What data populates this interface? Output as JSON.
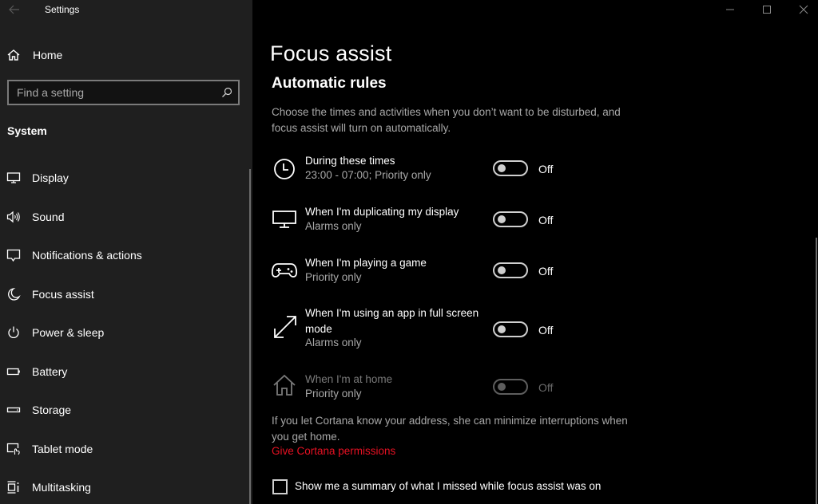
{
  "window": {
    "title": "Settings",
    "controls": {
      "minimize": "minimize",
      "maximize": "maximize",
      "close": "close"
    }
  },
  "sidebar": {
    "home_label": "Home",
    "search": {
      "placeholder": "Find a setting",
      "value": ""
    },
    "section_title": "System",
    "items": [
      {
        "label": "Display",
        "icon": "monitor-icon"
      },
      {
        "label": "Sound",
        "icon": "speaker-icon"
      },
      {
        "label": "Notifications & actions",
        "icon": "notification-icon"
      },
      {
        "label": "Focus assist",
        "icon": "moon-icon"
      },
      {
        "label": "Power & sleep",
        "icon": "power-icon"
      },
      {
        "label": "Battery",
        "icon": "battery-icon"
      },
      {
        "label": "Storage",
        "icon": "storage-icon"
      },
      {
        "label": "Tablet mode",
        "icon": "tablet-mode-icon"
      },
      {
        "label": "Multitasking",
        "icon": "multitasking-icon"
      }
    ]
  },
  "main": {
    "page_title": "Focus assist",
    "section_title": "Automatic rules",
    "description": "Choose the times and activities when you don’t want to be disturbed, and focus assist will turn on automatically.",
    "rules": [
      {
        "title": "During these times",
        "subtitle": "23:00 - 07:00; Priority only",
        "state": "Off",
        "on": false,
        "enabled": true,
        "icon": "clock-icon"
      },
      {
        "title": "When I'm duplicating my display",
        "subtitle": "Alarms only",
        "state": "Off",
        "on": false,
        "enabled": true,
        "icon": "monitor-icon"
      },
      {
        "title": "When I'm playing a game",
        "subtitle": "Priority only",
        "state": "Off",
        "on": false,
        "enabled": true,
        "icon": "gamepad-icon"
      },
      {
        "title": "When I'm using an app in full screen mode",
        "subtitle": "Alarms only",
        "state": "Off",
        "on": false,
        "enabled": true,
        "icon": "fullscreen-icon"
      },
      {
        "title": "When I'm at home",
        "subtitle": "Priority only",
        "state": "Off",
        "on": false,
        "enabled": false,
        "icon": "home-icon"
      }
    ],
    "cortana_note": "If you let Cortana know your address, she can minimize interruptions when you get home.",
    "cortana_link": "Give Cortana permissions",
    "summary_checkbox": {
      "label": "Show me a summary of what I missed while focus assist was on",
      "checked": false
    }
  },
  "colors": {
    "sidebar_bg": "#1f1f1f",
    "main_bg": "#000000",
    "accent_link": "#e81123",
    "secondary_text": "#a8a8a8"
  }
}
